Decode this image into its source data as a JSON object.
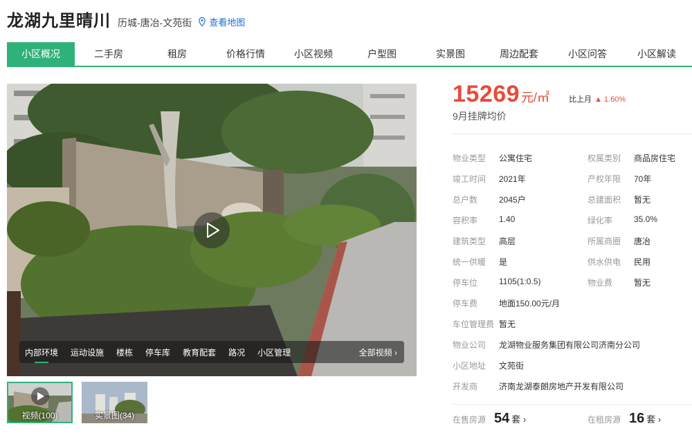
{
  "header": {
    "title": "龙湖九里晴川",
    "location": "历城-唐冶-文苑街",
    "map_link": "查看地图"
  },
  "nav": {
    "tabs": [
      {
        "label": "小区概况",
        "active": true
      },
      {
        "label": "二手房"
      },
      {
        "label": "租房"
      },
      {
        "label": "价格行情"
      },
      {
        "label": "小区视频"
      },
      {
        "label": "户型图"
      },
      {
        "label": "实景图"
      },
      {
        "label": "周边配套"
      },
      {
        "label": "小区问答"
      },
      {
        "label": "小区解读"
      }
    ]
  },
  "media": {
    "tabs": [
      "内部环境",
      "运动设施",
      "楼栋",
      "停车库",
      "教育配套",
      "路况",
      "小区管理"
    ],
    "all_label": "全部视频 ›",
    "thumbs": [
      {
        "label": "视频(100)"
      },
      {
        "label": "实景图(34)"
      }
    ]
  },
  "price": {
    "value": "15269",
    "unit": "元/㎡",
    "mom_label": "比上月",
    "mom_value": "▲ 1.60%",
    "caption": "9月挂牌均价"
  },
  "properties": {
    "rows": [
      [
        {
          "k": "物业类型",
          "v": "公寓住宅"
        },
        {
          "k": "权属类别",
          "v": "商品房住宅"
        }
      ],
      [
        {
          "k": "竣工时间",
          "v": "2021年"
        },
        {
          "k": "产权年限",
          "v": "70年"
        }
      ],
      [
        {
          "k": "总户数",
          "v": "2045户"
        },
        {
          "k": "总建面积",
          "v": "暂无"
        }
      ],
      [
        {
          "k": "容积率",
          "v": "1.40"
        },
        {
          "k": "绿化率",
          "v": "35.0%"
        }
      ],
      [
        {
          "k": "建筑类型",
          "v": "高层"
        },
        {
          "k": "所属商圈",
          "v": "唐冶"
        }
      ],
      [
        {
          "k": "统一供暖",
          "v": "是"
        },
        {
          "k": "供水供电",
          "v": "民用"
        }
      ],
      [
        {
          "k": "停车位",
          "v": "1105(1:0.5)"
        },
        {
          "k": "物业费",
          "v": "暂无"
        }
      ],
      [
        {
          "k": "停车费",
          "v": "地面150.00元/月"
        }
      ],
      [
        {
          "k": "车位管理费",
          "v": "暂无"
        }
      ],
      [
        {
          "k": "物业公司",
          "v": "龙湖物业服务集团有限公司济南分公司"
        }
      ],
      [
        {
          "k": "小区地址",
          "v": "文苑街"
        }
      ],
      [
        {
          "k": "开发商",
          "v": "济南龙湖泰朗房地产开发有限公司"
        }
      ]
    ]
  },
  "listings": {
    "sale": {
      "label": "在售房源",
      "count": "54",
      "unit": "套 ›"
    },
    "rent": {
      "label": "在租房源",
      "count": "16",
      "unit": "套 ›"
    }
  },
  "colors": {
    "accent": "#2fb27a",
    "price": "#e84b3a",
    "link": "#1c6fd1"
  }
}
